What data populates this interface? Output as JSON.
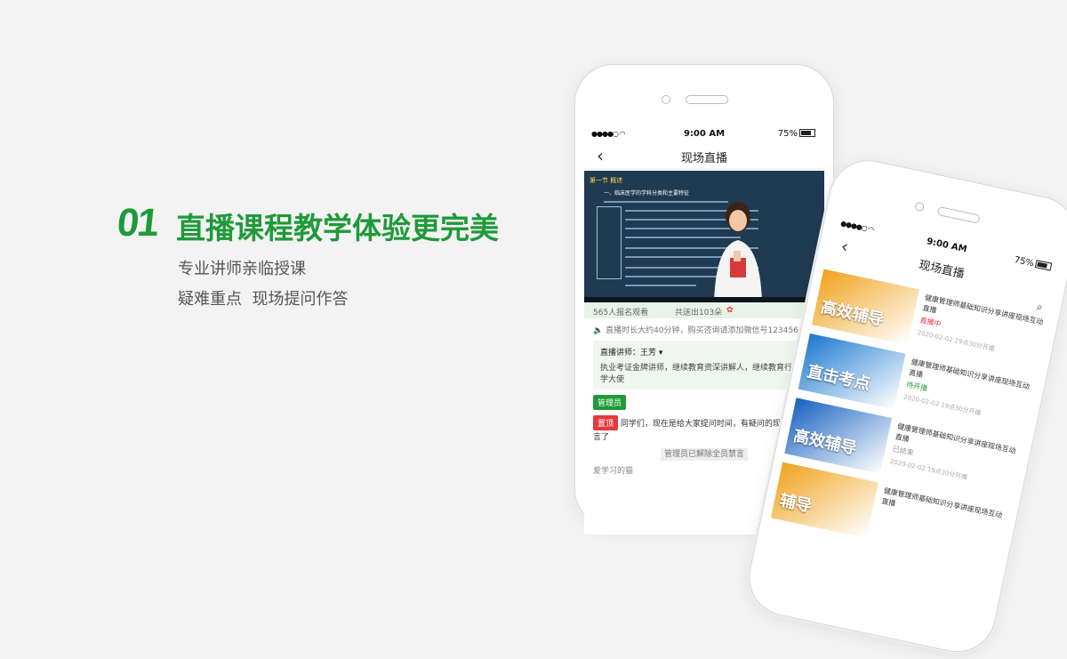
{
  "hero": {
    "number": "01",
    "title": "直播课程教学体验更完美",
    "subtitle1": "专业讲师亲临授课",
    "subtitle2": "疑难重点  现场提问作答"
  },
  "colors": {
    "brand_green": "#1f9a3a",
    "live_red": "#e4393c"
  },
  "phone1": {
    "status": {
      "time": "9:00 AM",
      "battery": "75%"
    },
    "nav_title": "现场直播",
    "video": {
      "section_label": "第一节  概述",
      "heading": "一、临床医学的学科分类和主要特征"
    },
    "viewers": "565人报名观看",
    "flowers": "共送出103朵",
    "notice": "直播时长大约40分钟，购买咨询请添加微信号123456",
    "teacher": {
      "label": "直播讲师：王芳",
      "desc": "执业考证金牌讲师，继续教育资深讲解人，继续教育行业助学大使"
    },
    "admin_tag": "管理员",
    "pin_tag": "置顶",
    "pin_msg": "同学们，现在是给大家提问时间，有疑问的现在可以发言了",
    "system_msg": "管理员已解除全员禁言",
    "next_user": "爱学习的猫"
  },
  "phone2": {
    "status": {
      "time": "9:00 AM",
      "battery": "75%"
    },
    "nav_title": "现场直播",
    "courses": [
      {
        "thumb_text": "高效辅导",
        "title": "健康管理师基础知识分享讲座现场互动直播",
        "state": "直播中",
        "date": "2020-02-02  19点30分开播",
        "bg": "#f0a21b",
        "state_color": "#e4393c"
      },
      {
        "thumb_text": "直击考点",
        "title": "健康管理师基础知识分享讲座现场互动直播",
        "state": "待开播",
        "date": "2020-02-02  19点30分开播",
        "bg": "#1b78d0",
        "state_color": "#1f9a3a"
      },
      {
        "thumb_text": "高效辅导",
        "title": "健康管理师基础知识分享讲座现场互动直播",
        "state": "已结束",
        "date": "2020-02-02  19点30分开播",
        "bg": "#1560c0",
        "state_color": "#999999"
      },
      {
        "thumb_text": "辅导",
        "title": "健康管理师基础知识分享讲座现场互动直播",
        "state": "",
        "date": "",
        "bg": "#f0a21b",
        "state_color": "#999999"
      }
    ]
  }
}
